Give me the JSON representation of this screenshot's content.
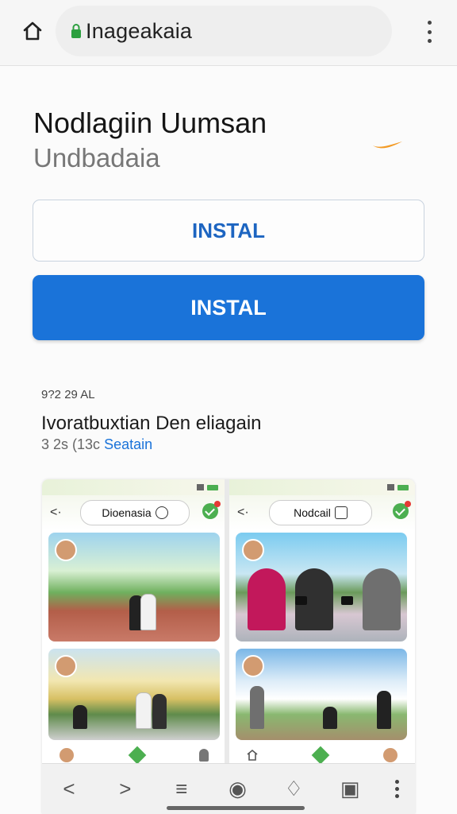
{
  "browser": {
    "url": "Inageakaia"
  },
  "app": {
    "title": "Nodlagiin Uumsan",
    "subtitle": "Undbadaia",
    "install_secondary": "INSTAL",
    "install_primary": "INSTAL",
    "meta_small": "9?2 29 AL",
    "meta_title": "Ivoratbuxtian Den eliagain",
    "meta_line_prefix": "3 2s (13c",
    "meta_line_link": "Seatain"
  },
  "screenshots": {
    "phone1": {
      "search": "Dioenasia"
    },
    "phone2": {
      "search": "Nodcail"
    }
  },
  "colors": {
    "primary": "#1a73d9",
    "outline": "#c9d3df",
    "background": "#fbfbfb"
  }
}
